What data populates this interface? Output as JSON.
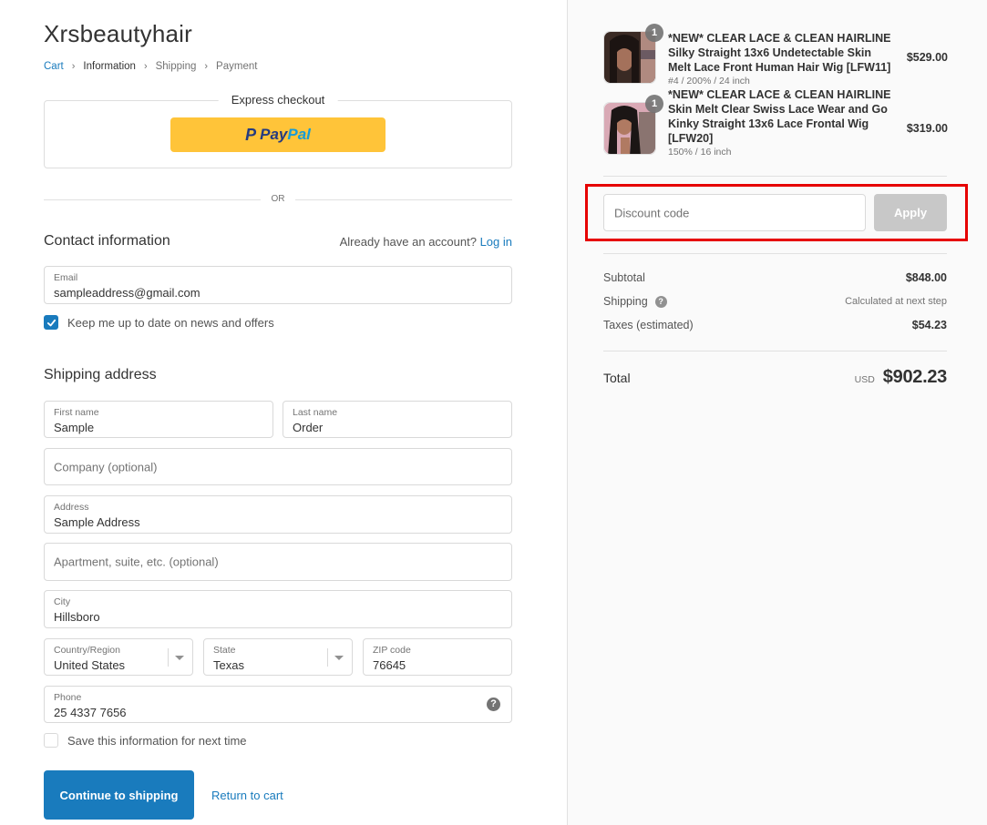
{
  "header": {
    "shop_name": "Xrsbeautyhair",
    "breadcrumb": [
      {
        "label": "Cart",
        "state": "link"
      },
      {
        "label": "Information",
        "state": "current"
      },
      {
        "label": "Shipping",
        "state": "upcoming"
      },
      {
        "label": "Payment",
        "state": "upcoming"
      }
    ],
    "separator": ">"
  },
  "express_checkout": {
    "title": "Express checkout",
    "paypal_pay": "Pay",
    "paypal_pal": "Pal",
    "paypal_mark": "P",
    "or_label": "OR"
  },
  "contact": {
    "title": "Contact information",
    "account_prompt": "Already have an account?",
    "login_label": "Log in",
    "email": {
      "label": "Email",
      "value": "sampleaddress@gmail.com"
    },
    "newsletter": {
      "label": "Keep me up to date on news and offers",
      "checked": true
    }
  },
  "shipping": {
    "title": "Shipping address",
    "first_name": {
      "label": "First name",
      "value": "Sample"
    },
    "last_name": {
      "label": "Last name",
      "value": "Order"
    },
    "company": {
      "placeholder": "Company (optional)"
    },
    "address": {
      "label": "Address",
      "value": "Sample Address"
    },
    "apartment": {
      "placeholder": "Apartment, suite, etc. (optional)"
    },
    "city": {
      "label": "City",
      "value": "Hillsboro"
    },
    "country": {
      "label": "Country/Region",
      "value": "United States"
    },
    "state": {
      "label": "State",
      "value": "Texas"
    },
    "zip": {
      "label": "ZIP code",
      "value": "76645"
    },
    "phone": {
      "label": "Phone",
      "value": "25 4337 7656",
      "help_icon": "?"
    },
    "save_info": {
      "label": "Save this information for next time",
      "checked": false
    }
  },
  "actions": {
    "continue_label": "Continue to shipping",
    "return_label": "Return to cart"
  },
  "order_summary": {
    "items": [
      {
        "quantity": "1",
        "name": "*NEW* CLEAR LACE & CLEAN HAIRLINE Silky Straight 13x6 Undetectable Skin Melt Lace Front Human Hair Wig [LFW11]",
        "variant": "#4 / 200% / 24 inch",
        "price": "$529.00"
      },
      {
        "quantity": "1",
        "name": "*NEW* CLEAR LACE & CLEAN HAIRLINE Skin Melt Clear Swiss Lace Wear and Go Kinky Straight 13x6 Lace Frontal Wig [LFW20]",
        "variant": "150% / 16 inch",
        "price": "$319.00"
      }
    ],
    "discount": {
      "placeholder": "Discount code",
      "apply_label": "Apply",
      "highlight_color": "#e60000"
    },
    "subtotal": {
      "label": "Subtotal",
      "value": "$848.00"
    },
    "shipping": {
      "label": "Shipping",
      "value": "Calculated at next step"
    },
    "taxes": {
      "label": "Taxes (estimated)",
      "value": "$54.23"
    },
    "total": {
      "label": "Total",
      "currency": "USD",
      "value": "$902.23"
    }
  },
  "colors": {
    "accent": "#197bbd",
    "paypal_yellow": "#ffc439",
    "apply_disabled": "#c8c8c8",
    "sidebar_bg": "#fafafa"
  }
}
